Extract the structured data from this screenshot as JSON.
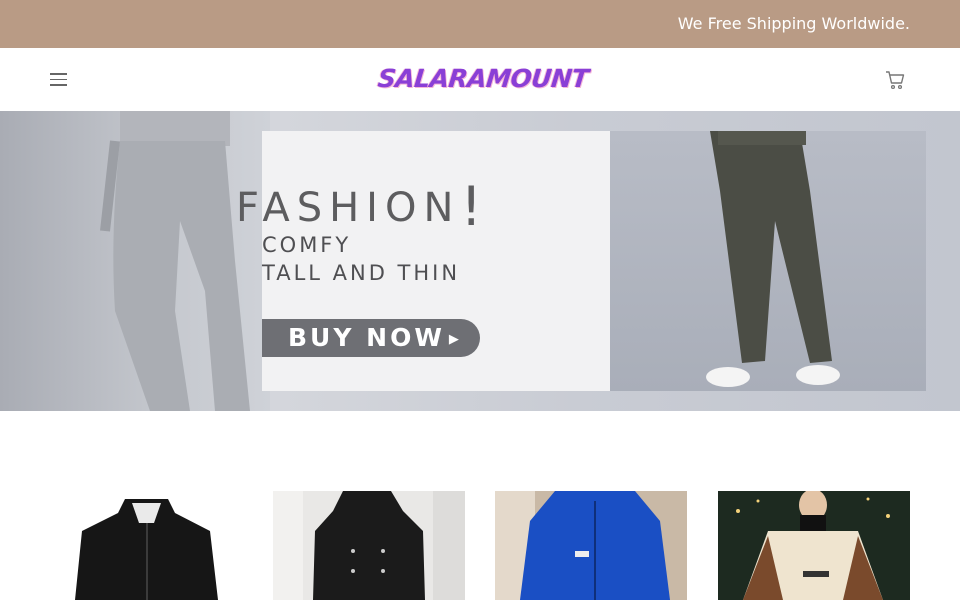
{
  "announcement": {
    "text": "We Free Shipping Worldwide."
  },
  "header": {
    "logo_text": "SALARAMOUNT",
    "menu_icon": "hamburger-menu-icon",
    "cart_icon": "shopping-cart-icon"
  },
  "hero": {
    "title": "FASHION",
    "title_mark": "!",
    "subtitle_line1": "COMFY",
    "subtitle_line2": "TALL AND THIN",
    "cta_label": "BUY NOW",
    "cta_arrow": "▶"
  },
  "products": [
    {
      "name": "black-hooded-jacket-product",
      "image": "black-jacket-image"
    },
    {
      "name": "black-coat-product",
      "image": "black-coat-image"
    },
    {
      "name": "blue-fleece-jacket-product",
      "image": "blue-fleece-image"
    },
    {
      "name": "cream-brown-fleece-jacket-product",
      "image": "cream-fleece-image"
    }
  ],
  "colors": {
    "announcement_bar": "#b99b85",
    "logo": "#8a3fd6",
    "cta_button": "#6e6f74"
  }
}
